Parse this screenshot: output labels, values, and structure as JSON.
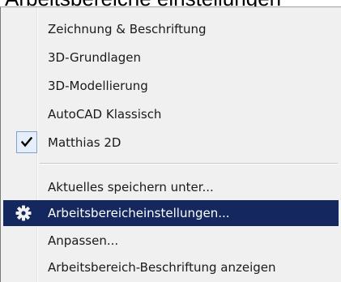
{
  "background_caption": "Arbeitsbereiche einstellungen",
  "menu": {
    "workspace_items": [
      {
        "label": "Zeichnung & Beschriftung",
        "checked": false
      },
      {
        "label": "3D-Grundlagen",
        "checked": false
      },
      {
        "label": "3D-Modellierung",
        "checked": false
      },
      {
        "label": "AutoCAD Klassisch",
        "checked": false
      },
      {
        "label": "Matthias 2D",
        "checked": true
      }
    ],
    "action_items": [
      {
        "label": "Aktuelles speichern unter...",
        "highlighted": false,
        "icon": null
      },
      {
        "label": "Arbeitsbereicheinstellungen...",
        "highlighted": true,
        "icon": "gear-icon"
      },
      {
        "label": "Anpassen...",
        "highlighted": false,
        "icon": null
      },
      {
        "label": "Arbeitsbereich-Beschriftung anzeigen",
        "highlighted": false,
        "icon": null
      }
    ]
  },
  "colors": {
    "menu_background": "#f0f0f0",
    "highlight": "#14275f",
    "highlight_text": "#ffffff",
    "text": "#1a1a1a"
  }
}
